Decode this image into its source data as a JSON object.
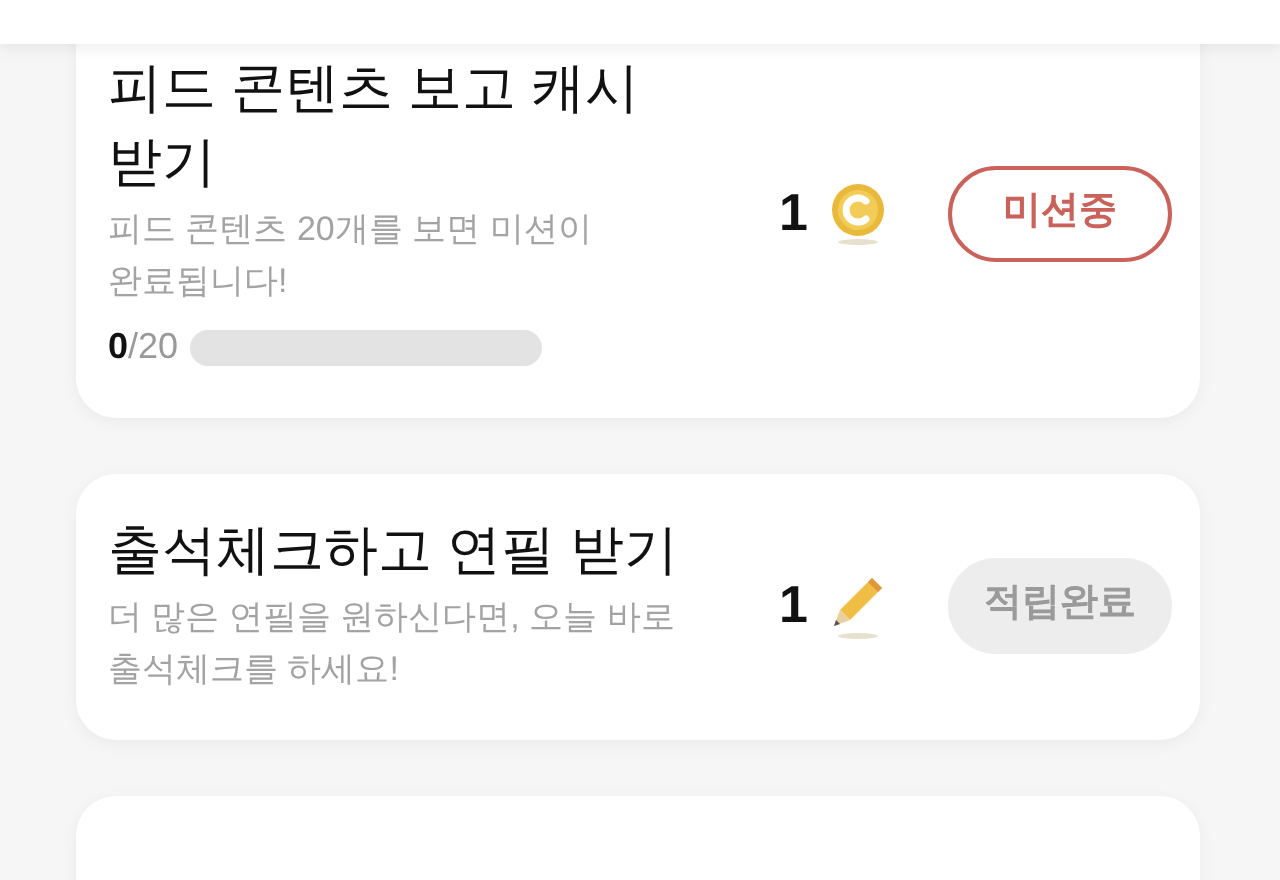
{
  "missions": [
    {
      "title": "피드 콘텐츠 보고 캐시 받기",
      "description": "피드 콘텐츠 20개를 보면 미션이 완료됩니다!",
      "progress": {
        "current": "0",
        "total": "/20",
        "level": 0
      },
      "reward": {
        "amount": "1",
        "kind": "coin"
      },
      "button": {
        "label": "미션중",
        "completed": false
      }
    },
    {
      "title": "출석체크하고 연필 받기",
      "description": "더 많은 연필을 원하신다면, 오늘 바로 출석체크를 하세요!",
      "reward": {
        "amount": "1",
        "kind": "pencil"
      },
      "button": {
        "label": "적립완료",
        "completed": true
      }
    }
  ]
}
